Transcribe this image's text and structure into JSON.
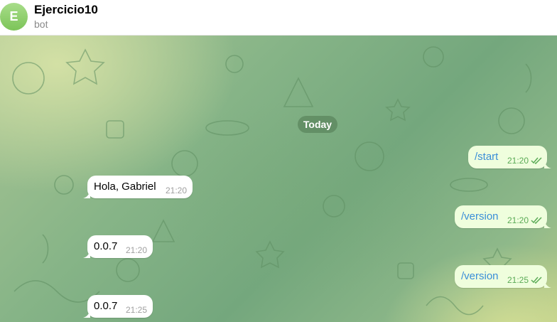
{
  "header": {
    "avatar_letter": "E",
    "title": "Ejercicio10",
    "subtitle": "bot"
  },
  "chat": {
    "date_label": "Today",
    "messages": [
      {
        "direction": "out",
        "text": "/start",
        "time": "21:20",
        "status": "read"
      },
      {
        "direction": "in",
        "text": "Hola, Gabriel",
        "time": "21:20"
      },
      {
        "direction": "out",
        "text": "/version",
        "time": "21:20",
        "status": "read"
      },
      {
        "direction": "in",
        "text": "0.0.7",
        "time": "21:20"
      },
      {
        "direction": "out",
        "text": "/version",
        "time": "21:25",
        "status": "read"
      },
      {
        "direction": "in",
        "text": "0.0.7",
        "time": "21:25"
      }
    ]
  },
  "colors": {
    "avatar": "#8fd16b",
    "outgoing_bubble": "#effedd",
    "incoming_bubble": "#ffffff",
    "command_link": "#3a8ed8",
    "outgoing_time": "#5bab57"
  },
  "icons": {
    "read_status": "double-check-icon"
  }
}
